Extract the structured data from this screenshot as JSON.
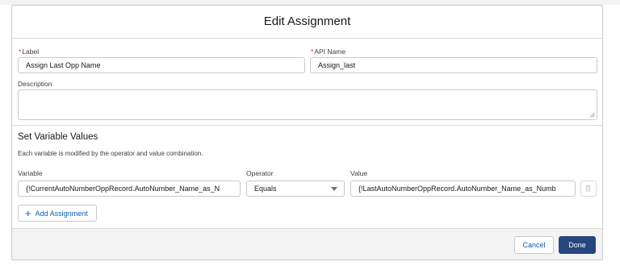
{
  "modal": {
    "title": "Edit Assignment"
  },
  "label_field": {
    "required_marker": "*",
    "label": "Label",
    "value": "Assign Last Opp Name"
  },
  "api_name_field": {
    "required_marker": "*",
    "label": "API Name",
    "value": "Assign_last"
  },
  "description_field": {
    "label": "Description",
    "value": ""
  },
  "variables_section": {
    "title": "Set Variable Values",
    "help_text": "Each variable is modified by the operator and value combination.",
    "column_headers": {
      "variable": "Variable",
      "operator": "Operator",
      "value": "Value"
    },
    "rows": [
      {
        "variable": "{!CurrentAutoNumberOppRecord.AutoNumber_Name_as_N",
        "operator": "Equals",
        "value": "{!LastAutoNumberOppRecord.AutoNumber_Name_as_Numb"
      }
    ],
    "add_button_label": "Add Assignment",
    "delete_icon": "trash-icon"
  },
  "footer": {
    "cancel_label": "Cancel",
    "done_label": "Done"
  },
  "colors": {
    "brand": "#27467e",
    "link": "#0b5cab",
    "required": "#c23934",
    "border": "#c9c9c9",
    "footer_bg": "#f3f3f3"
  }
}
